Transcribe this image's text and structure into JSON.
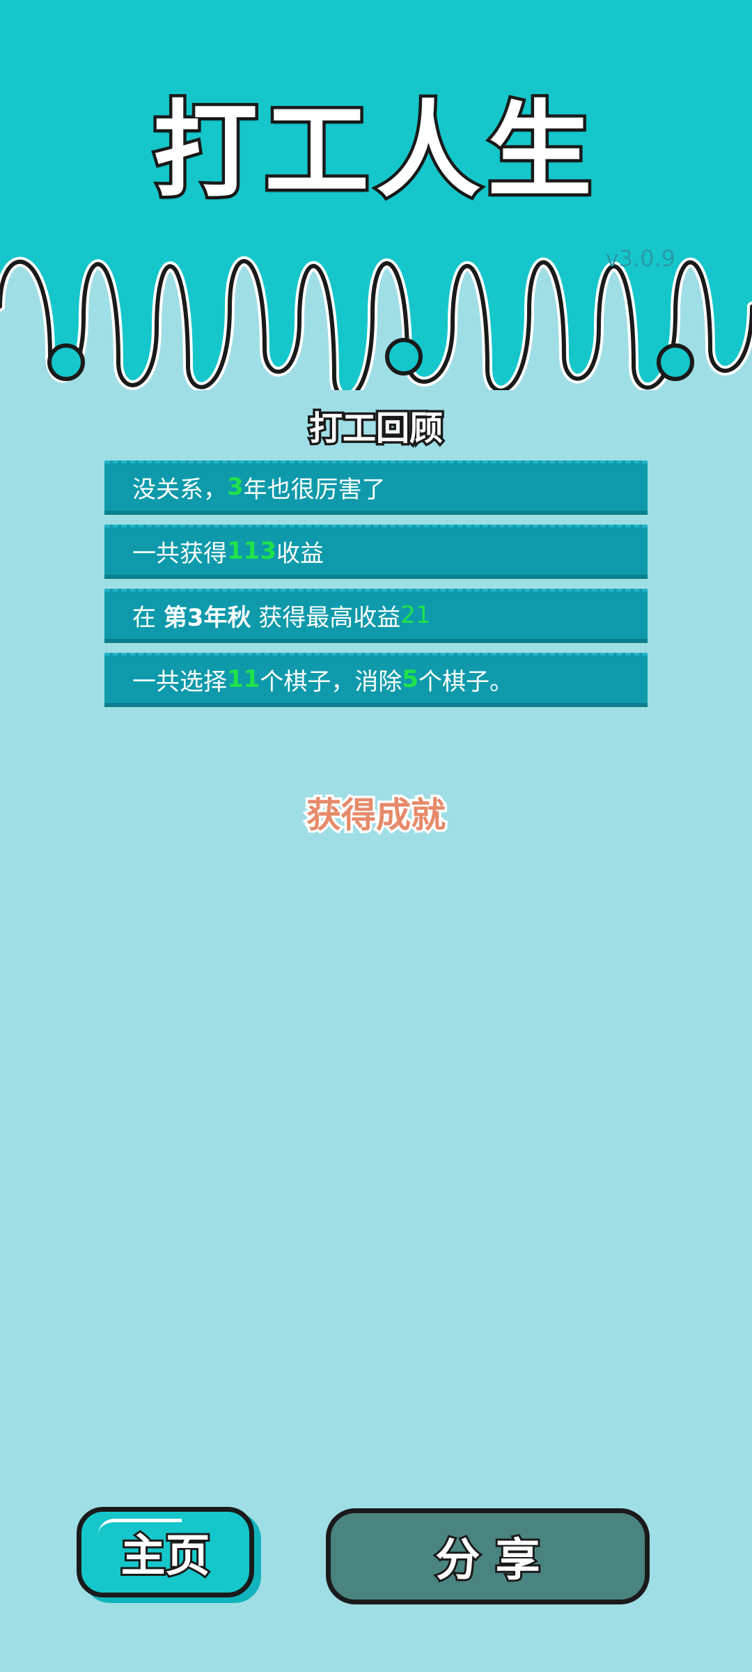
{
  "app": {
    "title": "打工人生",
    "version": "v3.0.9"
  },
  "review": {
    "title": "打工回顾",
    "rows": [
      {
        "p1": "没关系，",
        "h1": "3",
        "p2": "年也很厉害了"
      },
      {
        "p1": "一共获得",
        "h1": "113",
        "p2": "收益"
      },
      {
        "p1": "在 ",
        "b1": "第3年秋",
        "p2": " 获得最高收益",
        "h1": "21"
      },
      {
        "p1": "一共选择",
        "h1": "11",
        "p2": "个棋子，消除",
        "h2": "5",
        "p3": "个棋子。"
      }
    ]
  },
  "achievements": {
    "title": "获得成就"
  },
  "buttons": {
    "home": "主页",
    "share": "分 享"
  },
  "colors": {
    "header_bg": "#15c7cb",
    "page_bg": "#a0dee6",
    "row_bg": "#0e9aab",
    "highlight": "#1fe24a",
    "achievement": "#e68a6a",
    "home_button": "#15c7cb",
    "share_button": "#4a8480"
  }
}
